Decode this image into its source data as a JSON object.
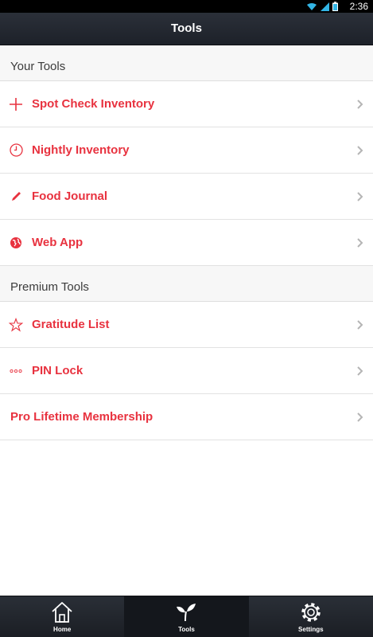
{
  "status_bar": {
    "time": "2:36"
  },
  "header": {
    "title": "Tools"
  },
  "sections": [
    {
      "title": "Your Tools",
      "items": [
        {
          "label": "Spot Check Inventory",
          "icon": "plus-icon"
        },
        {
          "label": "Nightly Inventory",
          "icon": "clock-icon"
        },
        {
          "label": "Food Journal",
          "icon": "pencil-icon"
        },
        {
          "label": "Web App",
          "icon": "globe-icon"
        }
      ]
    },
    {
      "title": "Premium Tools",
      "items": [
        {
          "label": "Gratitude List",
          "icon": "star-icon"
        },
        {
          "label": "PIN Lock",
          "icon": "dots-icon"
        },
        {
          "label": "Pro Lifetime Membership",
          "icon": ""
        }
      ]
    }
  ],
  "tab_bar": {
    "tabs": [
      {
        "label": "Home",
        "icon": "home-icon"
      },
      {
        "label": "Tools",
        "icon": "sprout-icon",
        "active": true
      },
      {
        "label": "Settings",
        "icon": "gear-icon"
      }
    ]
  },
  "colors": {
    "accent": "#e8323f",
    "header_bg": "#23272f",
    "section_bg": "#f7f7f7",
    "chevron": "#b5b5b5"
  }
}
